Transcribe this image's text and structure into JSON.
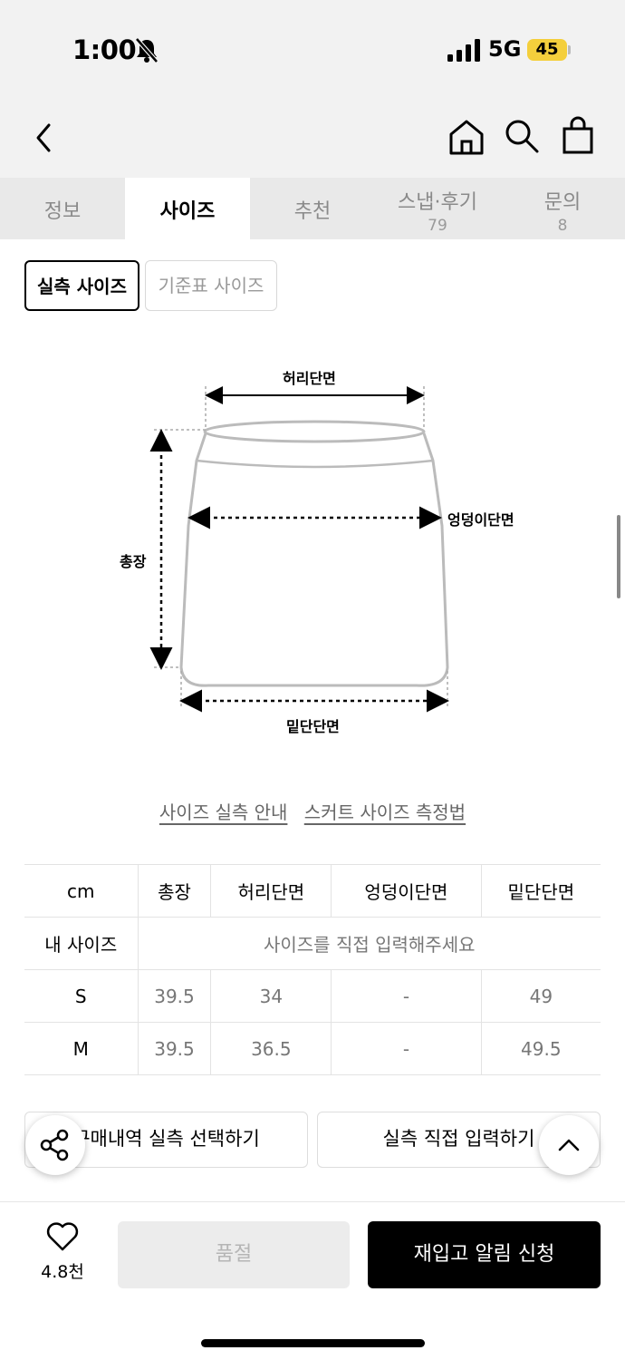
{
  "status_bar": {
    "time": "1:00",
    "network": "5G",
    "battery": "45"
  },
  "header": {
    "icons": [
      "chevron-left-icon",
      "home-icon",
      "search-icon",
      "shopping-bag-icon"
    ]
  },
  "tabs": [
    {
      "label": "정보",
      "count": ""
    },
    {
      "label": "사이즈",
      "count": "",
      "active": true
    },
    {
      "label": "추천",
      "count": ""
    },
    {
      "label": "스냅·후기",
      "count": "79"
    },
    {
      "label": "문의",
      "count": "8"
    }
  ],
  "size_toggle": {
    "actual": "실측 사이즈",
    "standard": "기준표 사이즈"
  },
  "diagram": {
    "waist": "허리단면",
    "hip": "엉덩이단면",
    "length": "총장",
    "hem": "밑단단면"
  },
  "links": {
    "guide": "사이즈 실측 안내",
    "method": "스커트 사이즈 측정법"
  },
  "table": {
    "headers": [
      "cm",
      "총장",
      "허리단면",
      "엉덩이단면",
      "밑단단면"
    ],
    "my_size_label": "내 사이즈",
    "my_size_placeholder": "사이즈를 직접 입력해주세요",
    "rows": [
      [
        "S",
        "39.5",
        "34",
        "-",
        "49"
      ],
      [
        "M",
        "39.5",
        "36.5",
        "-",
        "49.5"
      ]
    ]
  },
  "actions": {
    "purchase_select": "구매내역 실측 선택하기",
    "direct_input": "실측 직접 입력하기"
  },
  "bottom_bar": {
    "likes": "4.8천",
    "soldout": "품절",
    "restock": "재입고 알림 신청"
  },
  "colors": {
    "accent": "#000000",
    "battery": "#f4cf3c",
    "tab_bg": "#e9e9e9"
  }
}
